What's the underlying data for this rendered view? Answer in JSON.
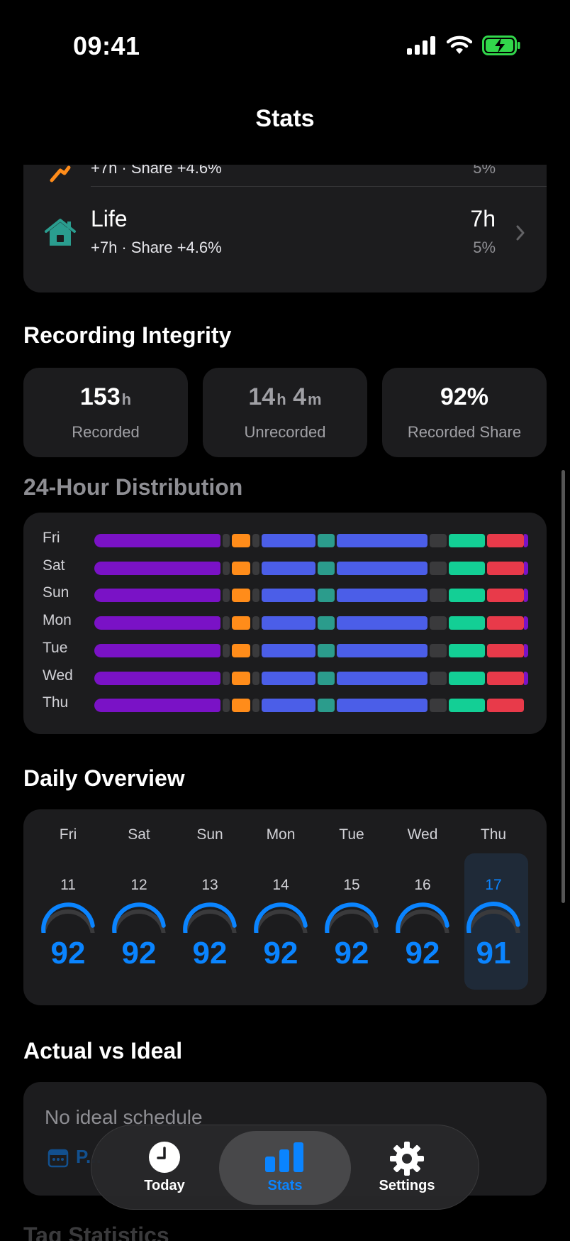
{
  "status_bar": {
    "time": "09:41"
  },
  "nav": {
    "title": "Stats"
  },
  "categories": [
    {
      "name": "",
      "sub": "+7h · Share +4.6%",
      "value": "",
      "pct": "5%",
      "icon": "running-figure-icon"
    },
    {
      "name": "Life",
      "sub": "+7h · Share +4.6%",
      "value": "7h",
      "pct": "5%",
      "icon": "house-icon"
    }
  ],
  "integrity": {
    "title": "Recording Integrity",
    "recorded": {
      "value": "153",
      "unit": "h",
      "label": "Recorded"
    },
    "unrecorded": {
      "hours": "14",
      "h_unit": "h",
      "minutes": "4",
      "m_unit": "m",
      "label": "Unrecorded"
    },
    "share": {
      "value": "92%",
      "label": "Recorded Share"
    }
  },
  "distribution": {
    "title": "24-Hour Distribution",
    "days": [
      "Fri",
      "Sat",
      "Sun",
      "Mon",
      "Tue",
      "Wed",
      "Thu"
    ],
    "colors": {
      "sleep": "#7a12c6",
      "gap": "#3a3a3c",
      "orange": "#ff8c1a",
      "blue": "#4b5ee8",
      "teal": "#2b9c8c",
      "green": "#13cf95",
      "red": "#e83a4a"
    }
  },
  "daily": {
    "title": "Daily Overview",
    "days": [
      {
        "name": "Fri",
        "num": "11",
        "score": "92"
      },
      {
        "name": "Sat",
        "num": "12",
        "score": "92"
      },
      {
        "name": "Sun",
        "num": "13",
        "score": "92"
      },
      {
        "name": "Mon",
        "num": "14",
        "score": "92"
      },
      {
        "name": "Tue",
        "num": "15",
        "score": "92"
      },
      {
        "name": "Wed",
        "num": "16",
        "score": "92"
      },
      {
        "name": "Thu",
        "num": "17",
        "score": "91"
      }
    ],
    "accent": "#0a84ff"
  },
  "ideal": {
    "title": "Actual vs Ideal",
    "empty_text": "No ideal schedule",
    "button_label": "P..."
  },
  "tag_stats": {
    "title": "Tag Statistics"
  },
  "tabs": [
    {
      "label": "Today",
      "icon": "clock-icon"
    },
    {
      "label": "Stats",
      "icon": "bar-chart-icon"
    },
    {
      "label": "Settings",
      "icon": "gear-icon"
    }
  ]
}
